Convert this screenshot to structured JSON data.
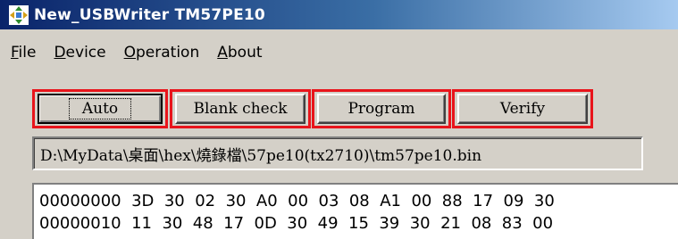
{
  "window": {
    "title": "New_USBWriter  TM57PE10"
  },
  "menu": [
    {
      "key": "F",
      "rest": "ile"
    },
    {
      "key": "D",
      "rest": "evice"
    },
    {
      "key": "O",
      "rest": "peration"
    },
    {
      "key": "A",
      "rest": "bout"
    }
  ],
  "toolbar": {
    "auto": "Auto",
    "blank_check": "Blank check",
    "program": "Program",
    "verify": "Verify"
  },
  "file_path": "D:\\MyData\\桌面\\hex\\燒錄檔\\57pe10(tx2710)\\tm57pe10.bin",
  "hex_rows": [
    {
      "addr": "00000000",
      "bytes": [
        "3D",
        "30",
        "02",
        "30",
        "A0",
        "00",
        "03",
        "08",
        "A1",
        "00",
        "88",
        "17",
        "09",
        "30"
      ]
    },
    {
      "addr": "00000010",
      "bytes": [
        "11",
        "30",
        "48",
        "17",
        "0D",
        "30",
        "49",
        "15",
        "39",
        "30",
        "21",
        "08",
        "83",
        "00"
      ]
    }
  ],
  "colors": {
    "highlight_border": "#e8141b",
    "title_start": "#0a246a",
    "title_end": "#a6caf0"
  }
}
